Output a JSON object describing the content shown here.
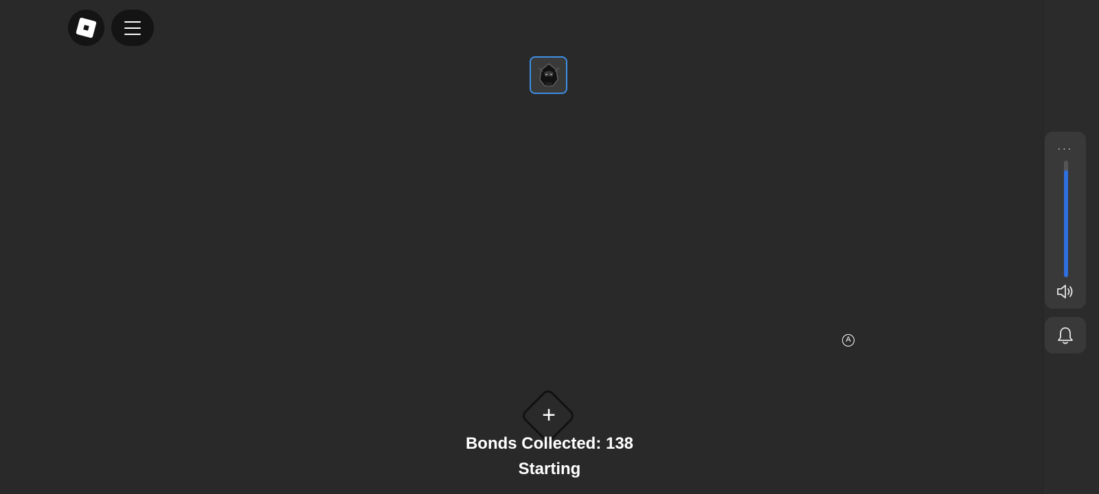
{
  "topbar": {
    "roblox_icon": "roblox-logo-icon",
    "menu_icon": "hamburger-menu-icon"
  },
  "avatar": {
    "icon": "hooded-ninja-avatar-icon",
    "border_color": "#3d8fe6"
  },
  "volume_panel": {
    "more_label": "···",
    "volume_level": 0.92,
    "accent_color": "#2f6fe0",
    "speaker_icon": "speaker-icon"
  },
  "notifications": {
    "icon": "bell-icon"
  },
  "marker": {
    "label": "A"
  },
  "action": {
    "plus_label": "+"
  },
  "hud": {
    "bonds_text": "Bonds Collected: 138",
    "status_text": "Starting"
  }
}
